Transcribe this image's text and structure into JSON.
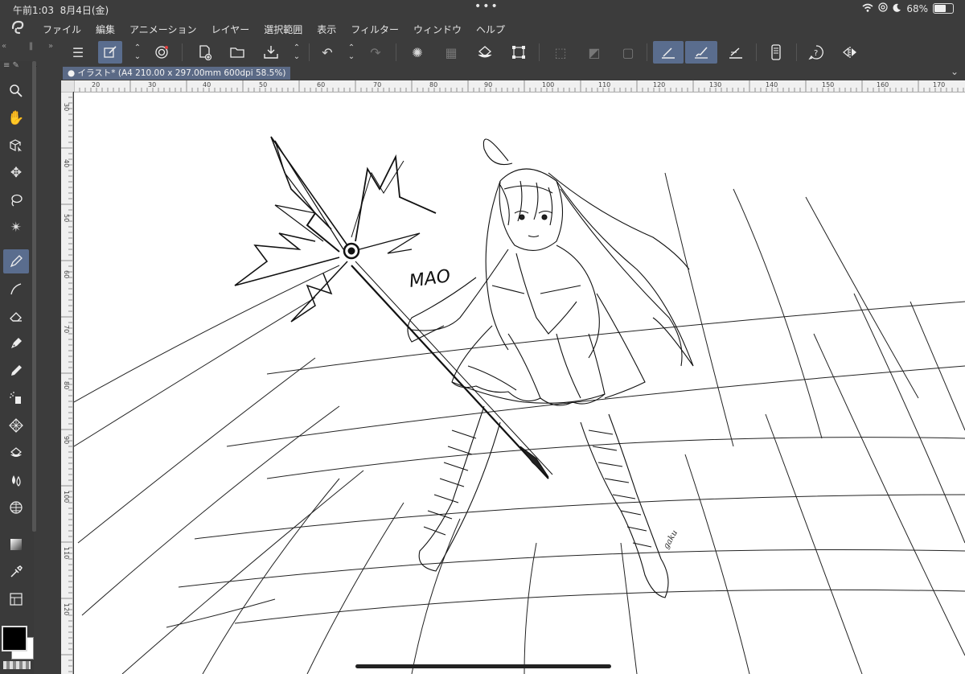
{
  "status_bar": {
    "time": "午前1:03",
    "date": "8月4日(金)",
    "battery_text": "68%",
    "battery_level": 0.68,
    "icons": [
      "wifi-icon",
      "at-icon",
      "moon-icon",
      "battery-icon"
    ]
  },
  "menu": {
    "items": [
      "ファイル",
      "編集",
      "アニメーション",
      "レイヤー",
      "選択範囲",
      "表示",
      "フィルター",
      "ウィンドウ",
      "ヘルプ"
    ]
  },
  "toolbar": {
    "icons": [
      "menu-icon",
      "edit-mode-icon",
      "up-down-arrows-icon",
      "app-logo-icon",
      "new-canvas-icon",
      "open-folder-icon",
      "save-icon",
      "up-down-arrows-icon",
      "undo-icon",
      "up-down-arrows-icon",
      "redo-icon",
      "loading-icon",
      "clear-icon",
      "fill-icon",
      "transform-icon",
      "deselect-icon",
      "invert-icon",
      "selection-border-icon",
      "stabilizer-pen-icon",
      "stabilizer-brush-icon",
      "ruler-pen-icon",
      "device-icon",
      "help-icon",
      "flip-icon"
    ]
  },
  "document_tab": {
    "label": "● イラスト* (A4 210.00 x 297.00mm 600dpi 58.5%)"
  },
  "rulers": {
    "horizontal": [
      "20",
      "30",
      "40",
      "50",
      "60",
      "70",
      "80",
      "90",
      "100",
      "110",
      "120",
      "130",
      "140",
      "150",
      "160",
      "170"
    ],
    "vertical": [
      "30",
      "40",
      "50",
      "60",
      "70",
      "80",
      "90",
      "100",
      "110",
      "120"
    ]
  },
  "tools": [
    "zoom-icon",
    "hand-icon",
    "object-icon",
    "move-icon",
    "lasso-icon",
    "magic-wand-icon",
    "pen-icon",
    "curve-icon",
    "eraser-icon",
    "pen-nib-icon",
    "pencil-icon",
    "airbrush-icon",
    "decoration-icon",
    "fill-bucket-icon",
    "blend-icon",
    "grid-icon",
    "gradient-icon",
    "eyedropper-icon",
    "layer-property-icon"
  ],
  "colors": {
    "main": "#000000",
    "sub": "#ffffff",
    "accent": "#5a6d8e"
  },
  "canvas": {
    "signature_text": "MAO",
    "artist_initials": "gaku"
  }
}
